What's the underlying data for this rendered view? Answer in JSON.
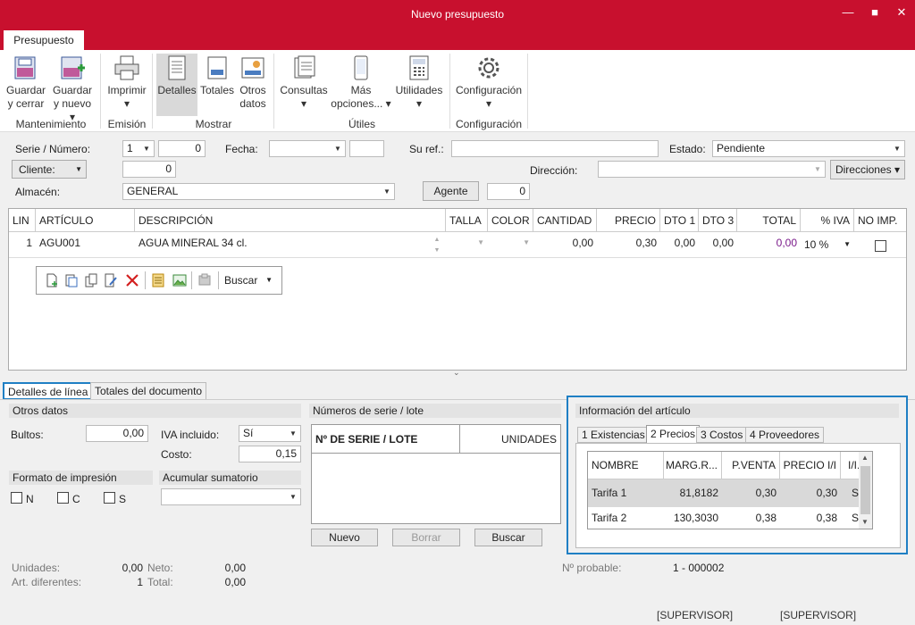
{
  "window": {
    "title": "Nuevo presupuesto",
    "minimize": "—",
    "maximize": "■",
    "close": "✕"
  },
  "ribbon_tab": "Presupuesto",
  "ribbon": {
    "guardar_cerrar": [
      "Guardar",
      "y cerrar"
    ],
    "guardar_nuevo": [
      "Guardar",
      "y nuevo ▾"
    ],
    "imprimir": [
      "Imprimir",
      "▾"
    ],
    "detalles": "Detalles",
    "totales": "Totales",
    "otros_datos": [
      "Otros",
      "datos"
    ],
    "consultas": [
      "Consultas",
      "▾"
    ],
    "mas_opciones": [
      "Más",
      "opciones... ▾"
    ],
    "utilidades": [
      "Utilidades",
      "▾"
    ],
    "configuracion": [
      "Configuración",
      "▾"
    ],
    "groups": {
      "mantenimiento": "Mantenimiento",
      "emision": "Emisión",
      "mostrar": "Mostrar",
      "utiles": "Útiles",
      "configuracion": "Configuración"
    }
  },
  "form": {
    "serie_label": "Serie / Número:",
    "serie_value": "1",
    "numero_value": "0",
    "fecha_label": "Fecha:",
    "fecha_value": "",
    "suref_label": "Su ref.:",
    "suref_value": "",
    "estado_label": "Estado:",
    "estado_value": "Pendiente",
    "cliente_label": "Cliente:",
    "cliente_value": "0",
    "direccion_label": "Dirección:",
    "direccion_value": "",
    "direcciones_button": "Direcciones ▾",
    "almacen_label": "Almacén:",
    "almacen_value": "GENERAL",
    "agente_button": "Agente",
    "agente_value": "0"
  },
  "grid": {
    "headers": [
      "LIN",
      "ARTÍCULO",
      "DESCRIPCIÓN",
      "TALLA",
      "COLOR",
      "CANTIDAD",
      "PRECIO",
      "DTO 1",
      "DTO 3",
      "TOTAL",
      "% IVA",
      "NO IMP."
    ],
    "row": {
      "lin": "1",
      "articulo": "AGU001",
      "descripcion": "AGUA MINERAL 34 cl.",
      "talla": "",
      "color": "",
      "cantidad": "0,00",
      "precio": "0,30",
      "dto1": "0,00",
      "dto3": "0,00",
      "total": "0,00",
      "iva": "10 %"
    },
    "toolbar_search": "Buscar"
  },
  "bottom_tabs": {
    "detalles_linea": "Detalles de línea",
    "totales_documento": "Totales del documento"
  },
  "otros_datos": {
    "title": "Otros datos",
    "bultos_label": "Bultos:",
    "bultos_value": "0,00",
    "iva_incluido_label": "IVA incluido:",
    "iva_incluido_value": "Sí",
    "costo_label": "Costo:",
    "costo_value": "0,15",
    "formato_title": "Formato de impresión",
    "acumular_title": "Acumular sumatorio",
    "acumular_value": "",
    "checks": [
      "N",
      "C",
      "S"
    ]
  },
  "serie_lote": {
    "title": "Números de serie / lote",
    "col1": "Nº DE SERIE / LOTE",
    "col2": "UNIDADES",
    "nuevo": "Nuevo",
    "borrar": "Borrar",
    "buscar": "Buscar"
  },
  "info_articulo": {
    "title": "Información del artículo",
    "tabs": [
      "1 Existencias",
      "2 Precios",
      "3 Costos",
      "4 Proveedores"
    ],
    "headers": [
      "NOMBRE",
      "MARG.R...",
      "P.VENTA",
      "PRECIO I/I",
      "I/I."
    ],
    "rows": [
      {
        "nombre": "Tarifa 1",
        "marg": "81,8182",
        "pventa": "0,30",
        "precio_ii": "0,30",
        "ii": "Sí"
      },
      {
        "nombre": "Tarifa 2",
        "marg": "130,3030",
        "pventa": "0,38",
        "precio_ii": "0,38",
        "ii": "Sí"
      }
    ]
  },
  "summary": {
    "unidades_label": "Unidades:",
    "unidades_value": "0,00",
    "neto_label": "Neto:",
    "neto_value": "0,00",
    "art_dif_label": "Art. diferentes:",
    "art_dif_value": "1",
    "total_label": "Total:",
    "total_value": "0,00",
    "nprobable_label": "Nº probable:",
    "nprobable_value": "1 - 000002"
  },
  "status": {
    "user1": "[SUPERVISOR]",
    "user2": "[SUPERVISOR]"
  },
  "colors": {
    "brand": "#c8102e",
    "focus": "#1f7fc4",
    "total_text": "#7a1a8a"
  }
}
